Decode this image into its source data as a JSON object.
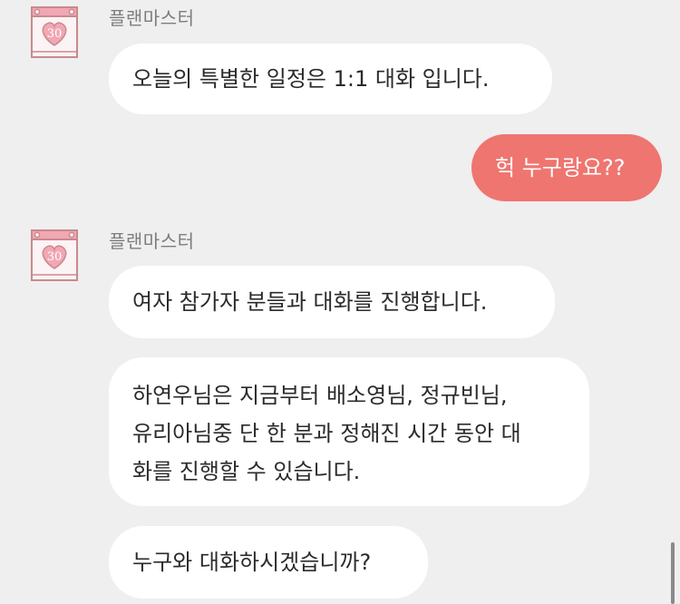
{
  "chat": {
    "group1": {
      "sender": "플랜마스터",
      "avatar_badge": "30",
      "message": "오늘의 특별한 일정은 1:1 대화 입니다."
    },
    "reply": {
      "message": "헉 누구랑요??"
    },
    "group2": {
      "sender": "플랜마스터",
      "avatar_badge": "30",
      "messages": [
        "여자 참가자 분들과 대화를 진행합니다.",
        "하연우님은 지금부터 배소영님, 정규빈님,",
        "유리아님중 단 한 분과 정해진 시간 동안 대",
        "화를 진행할 수 있습니다.",
        "누구와 대화하시겠습니까?"
      ]
    }
  },
  "colors": {
    "background": "#efefef",
    "bubble_other": "#ffffff",
    "bubble_mine": "#ef7570",
    "avatar_pink": "#f2a7b4",
    "avatar_border": "#c9898c"
  },
  "icons": {
    "avatar": "calendar-heart-icon"
  }
}
